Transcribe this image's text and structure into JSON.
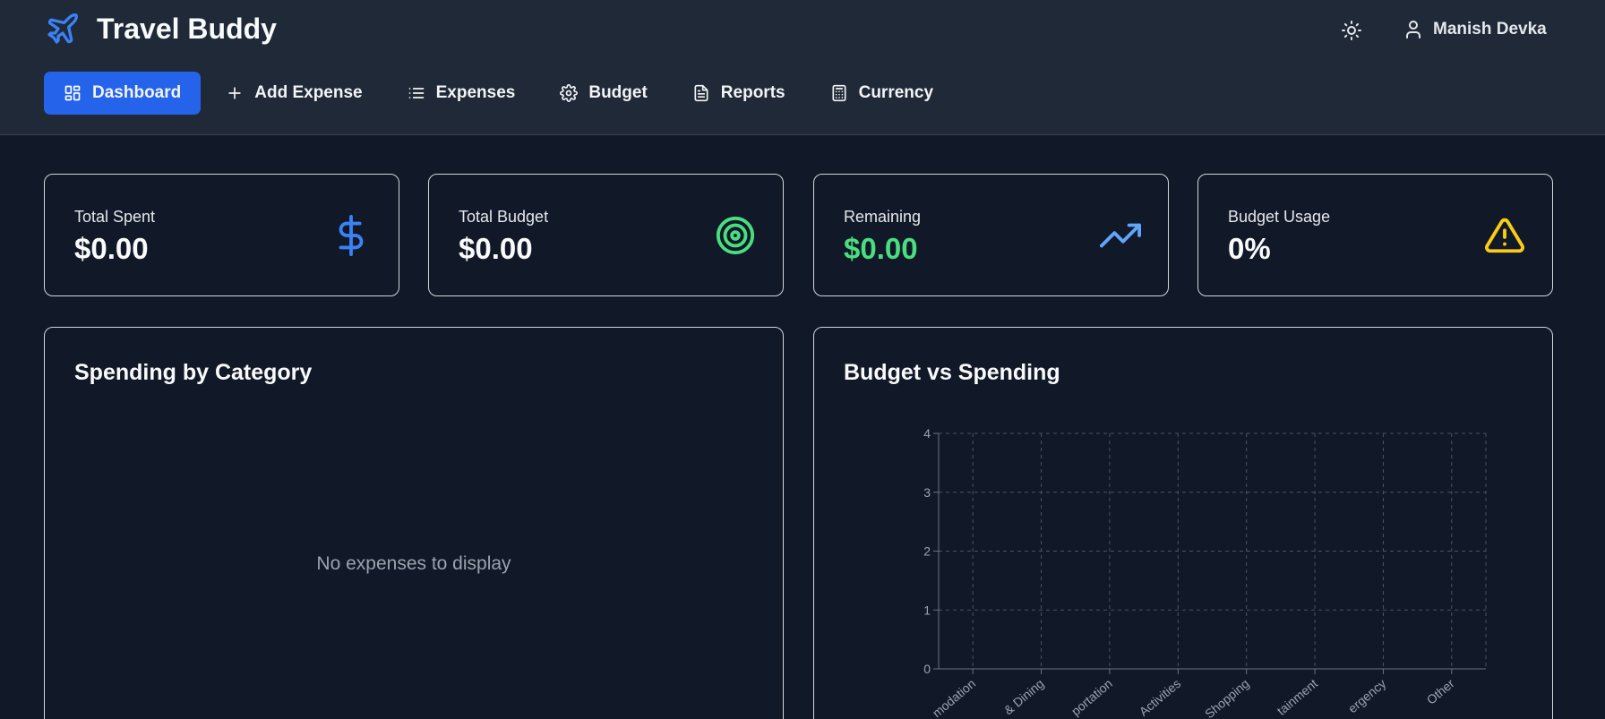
{
  "app": {
    "title": "Travel Buddy",
    "user_name": "Manish Devka"
  },
  "nav": [
    {
      "label": "Dashboard",
      "icon": "dashboard-icon",
      "active": true
    },
    {
      "label": "Add Expense",
      "icon": "plus-icon",
      "active": false
    },
    {
      "label": "Expenses",
      "icon": "list-icon",
      "active": false
    },
    {
      "label": "Budget",
      "icon": "gear-icon",
      "active": false
    },
    {
      "label": "Reports",
      "icon": "file-text-icon",
      "active": false
    },
    {
      "label": "Currency",
      "icon": "calculator-icon",
      "active": false
    }
  ],
  "stats": [
    {
      "label": "Total Spent",
      "value": "$0.00",
      "icon": "dollar-icon",
      "color": "#3b82f6"
    },
    {
      "label": "Total Budget",
      "value": "$0.00",
      "icon": "target-icon",
      "color": "#4ade80"
    },
    {
      "label": "Remaining",
      "value": "$0.00",
      "icon": "trending-up-icon",
      "color": "#4ade80"
    },
    {
      "label": "Budget Usage",
      "value": "0%",
      "icon": "alert-triangle-icon",
      "color": "#facc15"
    }
  ],
  "spending": {
    "title": "Spending by Category",
    "empty_text": "No expenses to display"
  },
  "budget_chart": {
    "title": "Budget vs Spending"
  },
  "chart_data": {
    "type": "bar",
    "title": "Budget vs Spending",
    "categories": [
      "Accommodation",
      "Food & Dining",
      "Transportation",
      "Activities",
      "Shopping",
      "Entertainment",
      "Emergency",
      "Other"
    ],
    "visible_category_labels": [
      "modation",
      "& Dining",
      "portation",
      "Activities",
      "Shopping",
      "tainment",
      "ergency",
      "Other"
    ],
    "series": [],
    "yticks": [
      "0",
      "1",
      "2",
      "3",
      "4"
    ],
    "ylim": [
      0,
      4
    ],
    "grid": true
  },
  "colors": {
    "accent": "#2563eb",
    "bg": "#111827",
    "header": "#1f2937"
  }
}
